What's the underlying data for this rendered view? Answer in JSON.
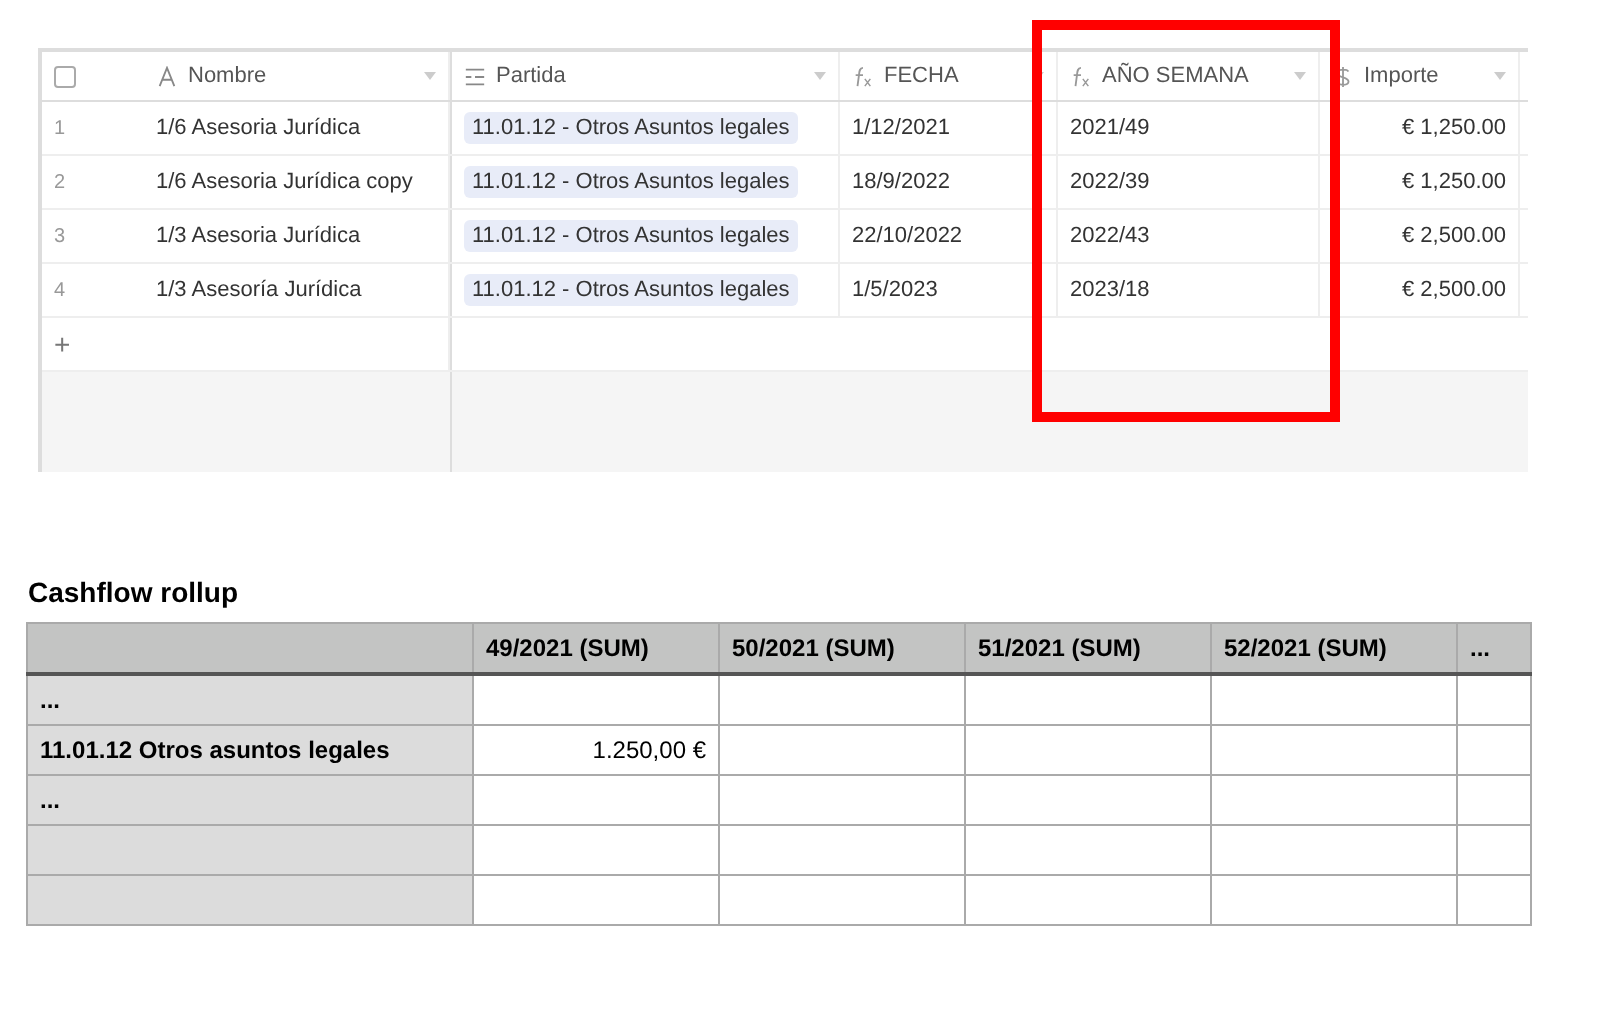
{
  "grid": {
    "select_all": {
      "checked": false
    },
    "columns": [
      {
        "kind": "text",
        "label": "Nombre"
      },
      {
        "kind": "link",
        "label": "Partida"
      },
      {
        "kind": "formula",
        "label": "FECHA"
      },
      {
        "kind": "formula",
        "label": "AÑO SEMANA"
      },
      {
        "kind": "currency",
        "label": "Importe"
      }
    ],
    "rows": [
      {
        "number": "1",
        "nombre": "1/6 Asesoria Jurídica",
        "partida": "11.01.12 - Otros Asuntos legales",
        "fecha": "1/12/2021",
        "semana": "2021/49",
        "importe": "€ 1,250.00"
      },
      {
        "number": "2",
        "nombre": "1/6 Asesoria Jurídica copy",
        "partida": "11.01.12 - Otros Asuntos legales",
        "fecha": "18/9/2022",
        "semana": "2022/39",
        "importe": "€ 1,250.00"
      },
      {
        "number": "3",
        "nombre": "1/3 Asesoria Jurídica",
        "partida": "11.01.12 - Otros Asuntos legales",
        "fecha": "22/10/2022",
        "semana": "2022/43",
        "importe": "€ 2,500.00"
      },
      {
        "number": "4",
        "nombre": "1/3 Asesoría Jurídica",
        "partida": "11.01.12 - Otros Asuntos legales",
        "fecha": "1/5/2023",
        "semana": "2023/18",
        "importe": "€ 2,500.00"
      }
    ],
    "add_row": "+"
  },
  "rollup": {
    "title": "Cashflow rollup",
    "columns": [
      "49/2021 (SUM)",
      "50/2021 (SUM)",
      "51/2021 (SUM)",
      "52/2021 (SUM)",
      "..."
    ],
    "rows": [
      {
        "label": "...",
        "cells": [
          "",
          "",
          "",
          "",
          ""
        ]
      },
      {
        "label": "11.01.12 Otros asuntos legales",
        "cells": [
          "1.250,00 €",
          "",
          "",
          "",
          ""
        ]
      },
      {
        "label": "...",
        "cells": [
          "",
          "",
          "",
          "",
          ""
        ]
      },
      {
        "label": "",
        "cells": [
          "",
          "",
          "",
          "",
          ""
        ]
      },
      {
        "label": "",
        "cells": [
          "",
          "",
          "",
          "",
          ""
        ]
      }
    ]
  }
}
